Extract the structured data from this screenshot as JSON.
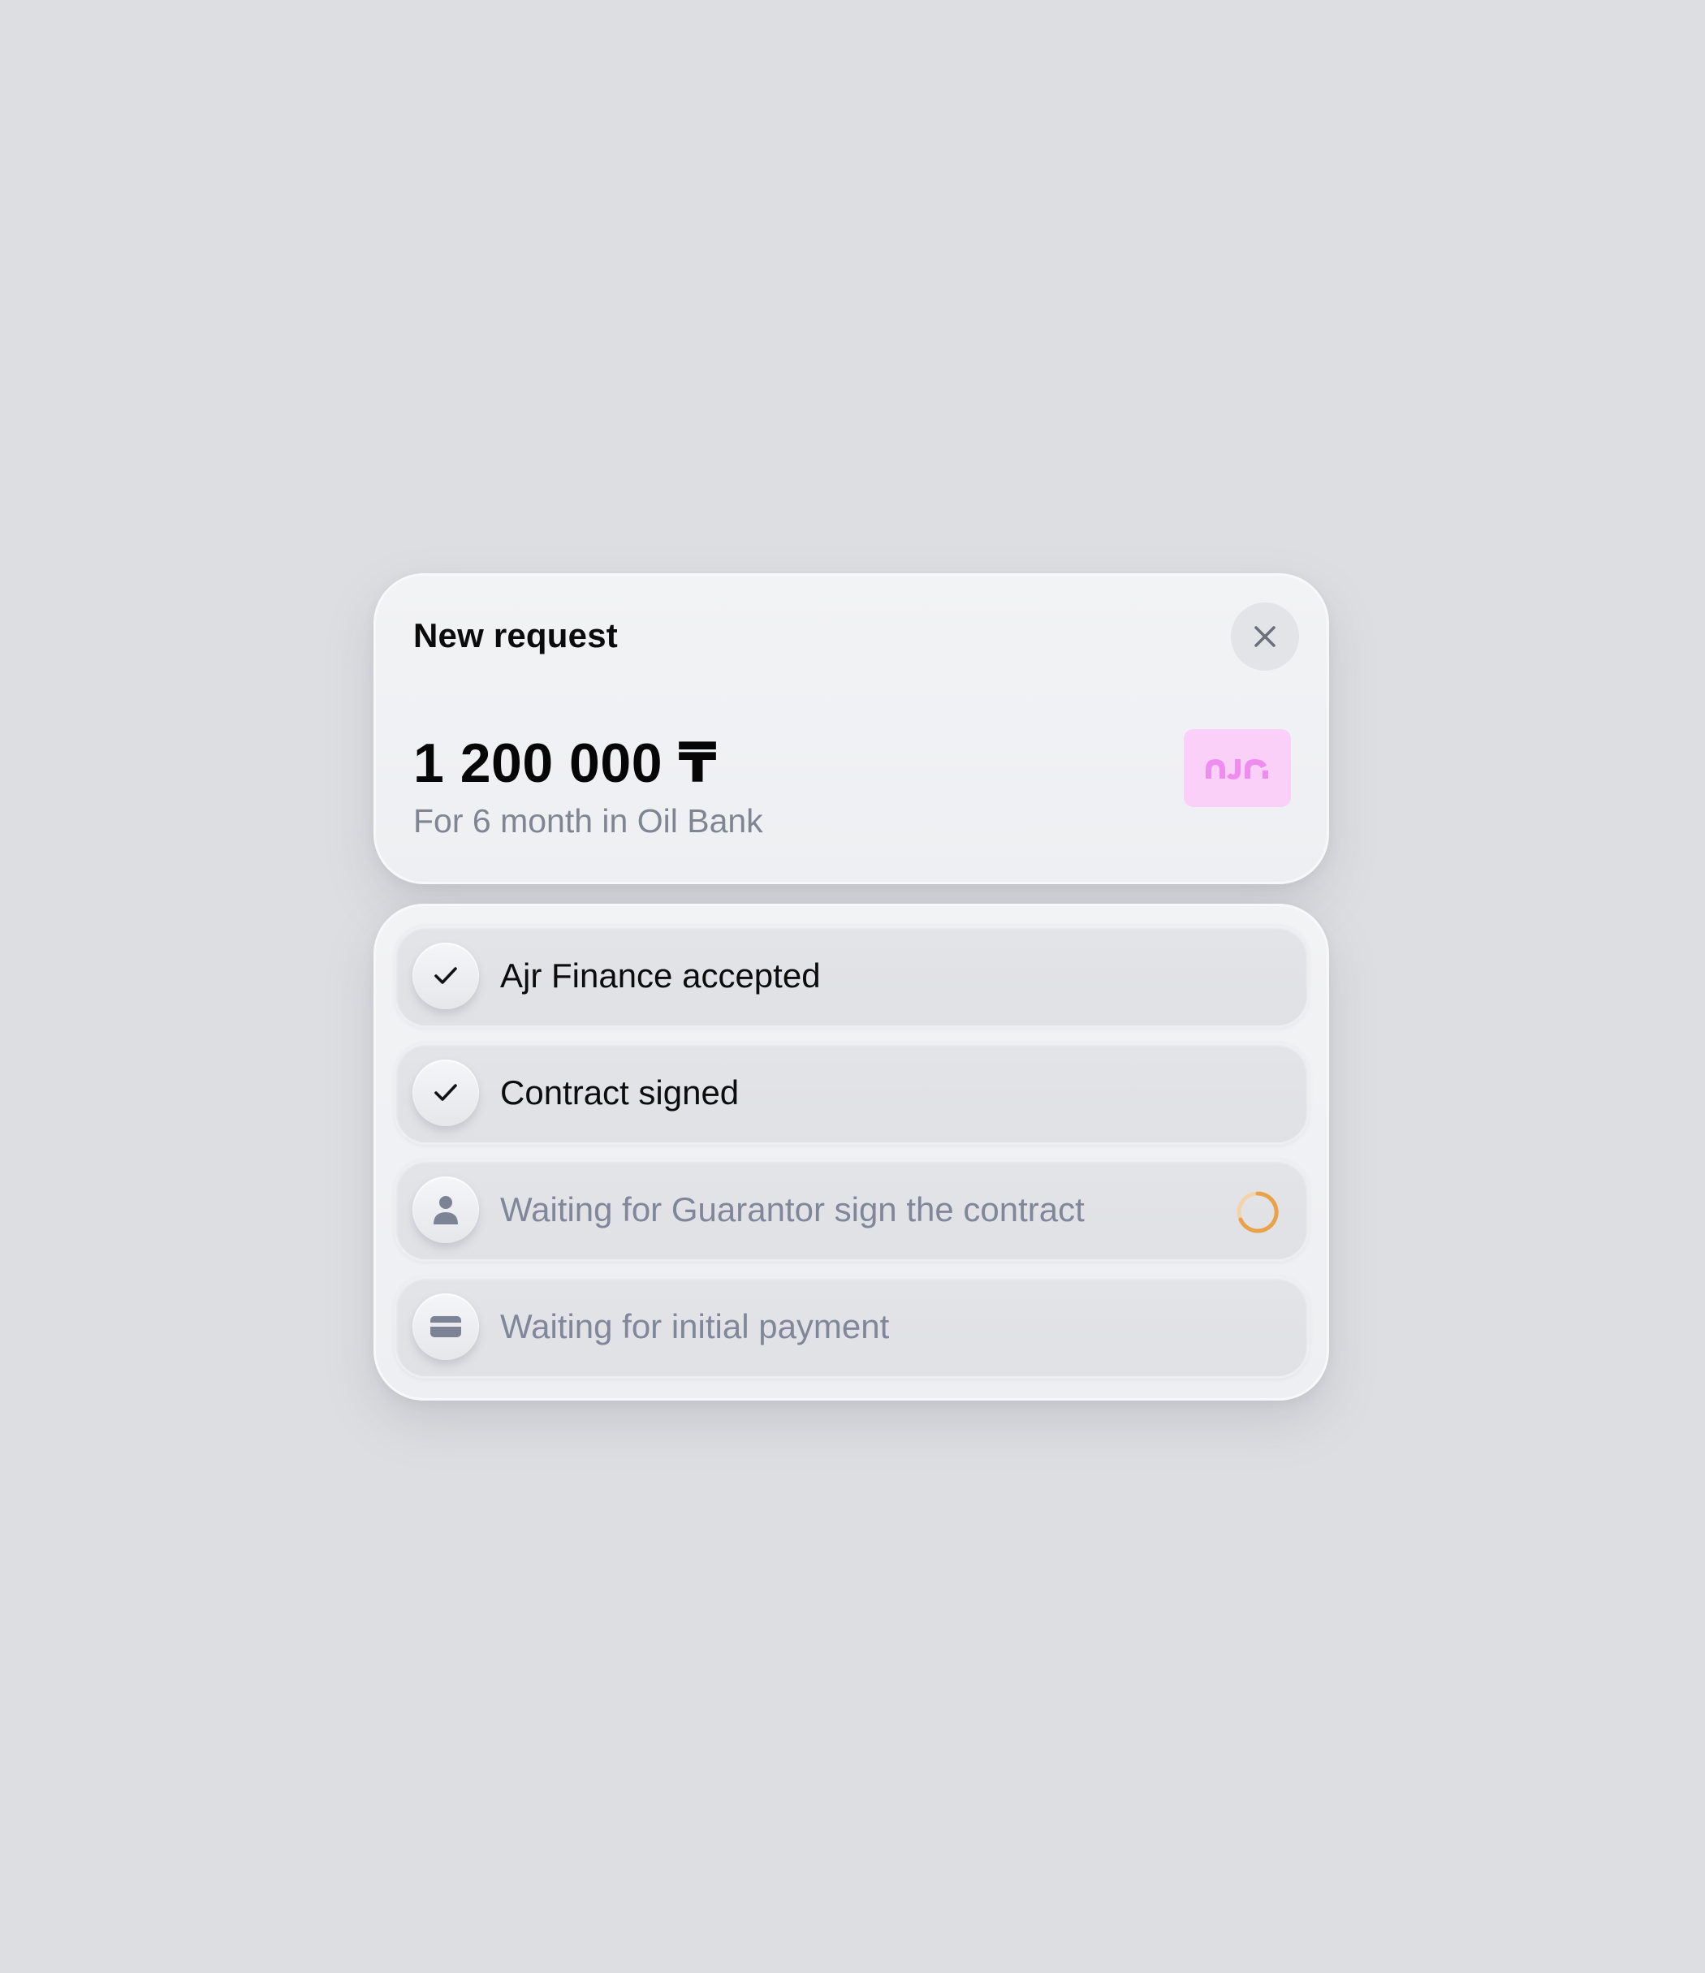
{
  "request": {
    "title": "New request",
    "amount": "1 200 000 ₸",
    "subtitle": "For 6 month in Oil Bank",
    "logo_text": "AJR",
    "close_icon": "close-icon"
  },
  "steps": [
    {
      "label": "Ajr Finance accepted",
      "icon": "check-icon",
      "status": "done"
    },
    {
      "label": "Contract signed",
      "icon": "check-icon",
      "status": "done"
    },
    {
      "label": "Waiting for Guarantor sign the contract",
      "icon": "person-icon",
      "status": "in-progress"
    },
    {
      "label": "Waiting for initial payment",
      "icon": "credit-card-icon",
      "status": "pending"
    }
  ],
  "colors": {
    "background": "#dddee2",
    "logo_bg": "#fad0f8",
    "logo_fg": "#ee8ded",
    "spinner": "#e8a24a",
    "pending_text": "#80879a"
  }
}
